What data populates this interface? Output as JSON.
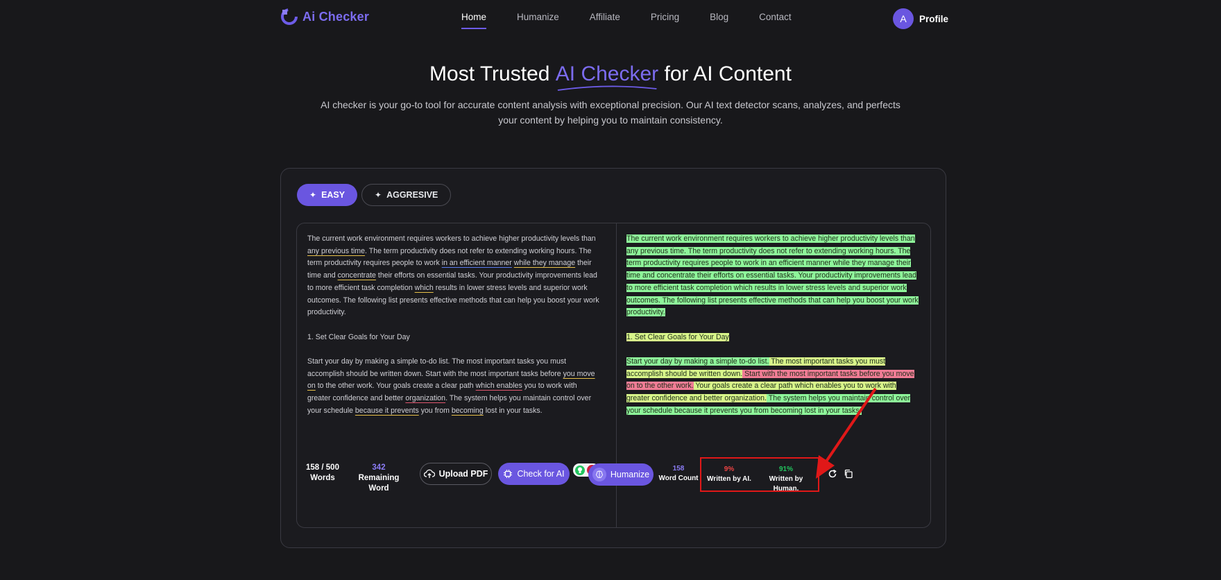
{
  "nav": {
    "logo_text": "Ai Checker",
    "links": [
      "Home",
      "Humanize",
      "Affiliate",
      "Pricing",
      "Blog",
      "Contact"
    ],
    "active": "Home",
    "avatar_letter": "A",
    "profile_label": "Profile"
  },
  "hero": {
    "title_pre": "Most Trusted ",
    "title_accent": "AI Checker",
    "title_post": " for AI Content",
    "subtitle": "AI checker is your go-to tool for accurate content analysis with exceptional precision. Our AI text detector scans, analyzes, and perfects your content by helping you to maintain consistency."
  },
  "modes": {
    "easy": "EASY",
    "aggressive": "AGGRESIVE"
  },
  "input": {
    "p1": [
      {
        "t": "The current work environment requires workers to achieve higher productivity levels than ",
        "u": ""
      },
      {
        "t": "any previous time",
        "u": "y"
      },
      {
        "t": ". The term productivity does not refer to extending working hours. The term productivity requires people to work ",
        "u": ""
      },
      {
        "t": "in an efficient manner",
        "u": "b"
      },
      {
        "t": " ",
        "u": ""
      },
      {
        "t": "while they manage",
        "u": "y"
      },
      {
        "t": " their time and ",
        "u": ""
      },
      {
        "t": "concentrate",
        "u": "y"
      },
      {
        "t": " their efforts on essential tasks. Your productivity improvements lead to more efficient task completion ",
        "u": ""
      },
      {
        "t": "which",
        "u": "y"
      },
      {
        "t": " results in lower stress levels and superior work outcomes. The following list presents effective methods that can help you boost your work productivity.",
        "u": ""
      }
    ],
    "p2": [
      {
        "t": "1. Set Clear Goals for Your Day",
        "u": ""
      }
    ],
    "p3": [
      {
        "t": "Start your day by making a simple to-do list. The most important tasks you must accomplish should be written down. Start with the most important tasks before ",
        "u": ""
      },
      {
        "t": "you move on",
        "u": "y"
      },
      {
        "t": " to the other work. Your goals create a clear path ",
        "u": ""
      },
      {
        "t": "which enables",
        "u": "r"
      },
      {
        "t": " you to work with greater confidence and better ",
        "u": ""
      },
      {
        "t": "organization",
        "u": "r"
      },
      {
        "t": ". The system helps you maintain control over your schedule ",
        "u": ""
      },
      {
        "t": "because it prevents",
        "u": "y"
      },
      {
        "t": " you from ",
        "u": ""
      },
      {
        "t": "becoming",
        "u": "y"
      },
      {
        "t": " lost in your tasks.",
        "u": ""
      }
    ],
    "badge_count": "4",
    "words_count": "158 / 500",
    "words_label": "Words",
    "remaining_count": "342",
    "remaining_label": "Remaining Word",
    "upload_label": "Upload PDF",
    "check_label": "Check for AI"
  },
  "output": {
    "p1": [
      {
        "t": "The current work environment requires workers to achieve higher productivity levels than any previous time.",
        "h": "g"
      },
      {
        "t": " The term productivity does not refer to extending working hours. The term productivity requires people to work in an efficient manner while they manage their time and concentrate their efforts on essential tasks. Your productivity improvements lead to more efficient task completion which results in lower stress levels and superior work outcomes.",
        "h": "g"
      },
      {
        "t": " The following list presents effective methods that can help you boost your work productivity.",
        "h": "g"
      }
    ],
    "p2": [
      {
        "t": "1. Set Clear Goals for Your Day",
        "h": "y"
      }
    ],
    "p3": [
      {
        "t": "Start your day by making a simple to-do list.",
        "h": "g"
      },
      {
        "t": " The most important tasks you must accomplish should be written down.",
        "h": "y"
      },
      {
        "t": " Start with the most important tasks before you move on to the other work.",
        "h": "p"
      },
      {
        "t": " Your goals create a clear path which enables you to work with greater confidence and better organization.",
        "h": "y"
      },
      {
        "t": " The system helps you maintain control over your schedule because it prevents you from becoming lost in your tasks.",
        "h": "g"
      }
    ],
    "humanize_label": "Humanize",
    "word_count": "158",
    "word_count_label": "Word Count",
    "ai_pct": "9%",
    "ai_label": "Written by AI.",
    "human_pct": "91%",
    "human_label": "Written by Human."
  },
  "colors": {
    "accent": "#6a56e0",
    "highlight_green": "#8ef59a",
    "highlight_yellow": "#d8f58a",
    "highlight_pink": "#f07c95",
    "annotation_red": "#e01818"
  }
}
